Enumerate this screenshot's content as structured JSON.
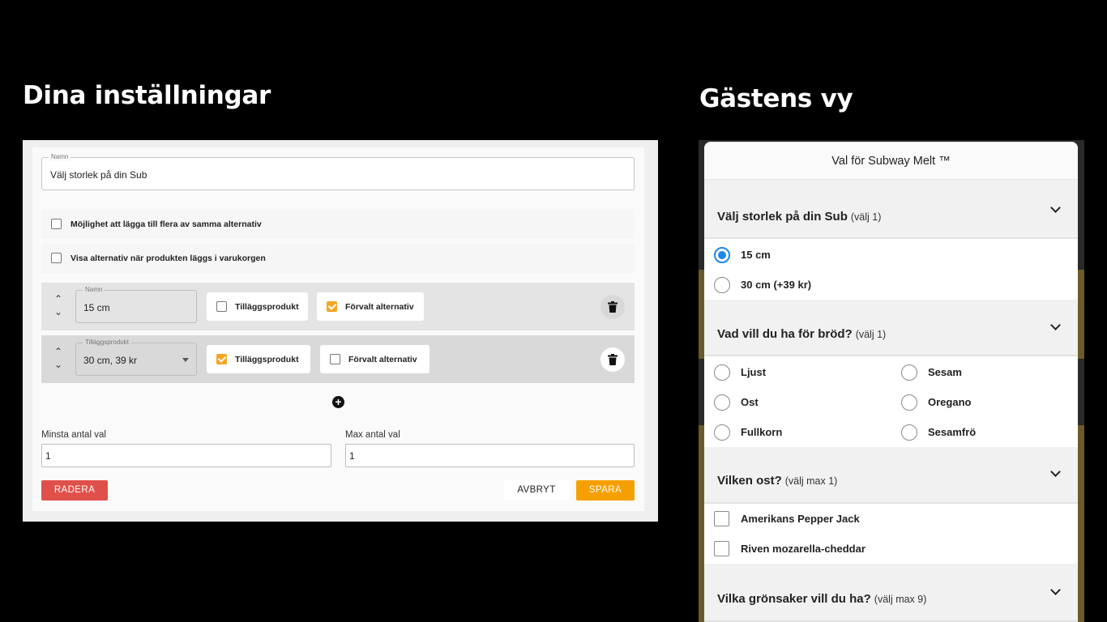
{
  "headings": {
    "left": "Dina inställningar",
    "right": "Gästens vy"
  },
  "settings": {
    "name_field": {
      "label": "Namn",
      "value": "Välj storlek på din Sub"
    },
    "checkboxes": [
      {
        "label": "Möjlighet att lägga till flera av samma alternativ",
        "checked": false
      },
      {
        "label": "Visa alternativ när produkten läggs i varukorgen",
        "checked": false
      }
    ],
    "options": [
      {
        "field_label": "Namn",
        "field_value": "15 cm",
        "addon_label": "Tilläggsprodukt",
        "addon_checked": false,
        "default_label": "Förvalt alternativ",
        "default_checked": true
      },
      {
        "field_label": "Tilläggsprodukt",
        "field_value": "30 cm, 39 kr",
        "addon_label": "Tilläggsprodukt",
        "addon_checked": true,
        "default_label": "Förvalt alternativ",
        "default_checked": false
      }
    ],
    "min_label": "Minsta antal val",
    "min_value": "1",
    "max_label": "Max antal val",
    "max_value": "1",
    "buttons": {
      "delete": "RADERA",
      "cancel": "AVBRYT",
      "save": "SPARA"
    },
    "colors": {
      "accent": "#f5a000",
      "danger": "#e0504a"
    }
  },
  "guest": {
    "title": "Val för Subway Melt ™",
    "sections": [
      {
        "question": "Välj storlek på din Sub",
        "hint": "(välj 1)",
        "type": "radio",
        "options": [
          {
            "label": "15 cm",
            "selected": true
          },
          {
            "label": "30 cm (+39 kr)",
            "selected": false
          }
        ]
      },
      {
        "question": "Vad vill du ha för bröd?",
        "hint": "(välj 1)",
        "type": "radio",
        "options": [
          {
            "label": "Ljust",
            "selected": false
          },
          {
            "label": "Sesam",
            "selected": false
          },
          {
            "label": "Ost",
            "selected": false
          },
          {
            "label": "Oregano",
            "selected": false
          },
          {
            "label": "Fullkorn",
            "selected": false
          },
          {
            "label": "Sesamfrö",
            "selected": false
          }
        ]
      },
      {
        "question": "Vilken ost?",
        "hint": "(välj max 1)",
        "type": "checkbox",
        "options": [
          {
            "label": "Amerikans Pepper Jack",
            "selected": false
          },
          {
            "label": "Riven mozarella-cheddar",
            "selected": false
          }
        ]
      },
      {
        "question": "Vilka grönsaker vill du ha?",
        "hint": "(välj max 9)",
        "type": "checkbox",
        "options": []
      }
    ],
    "colors": {
      "radio_selected": "#1e88e5"
    }
  }
}
